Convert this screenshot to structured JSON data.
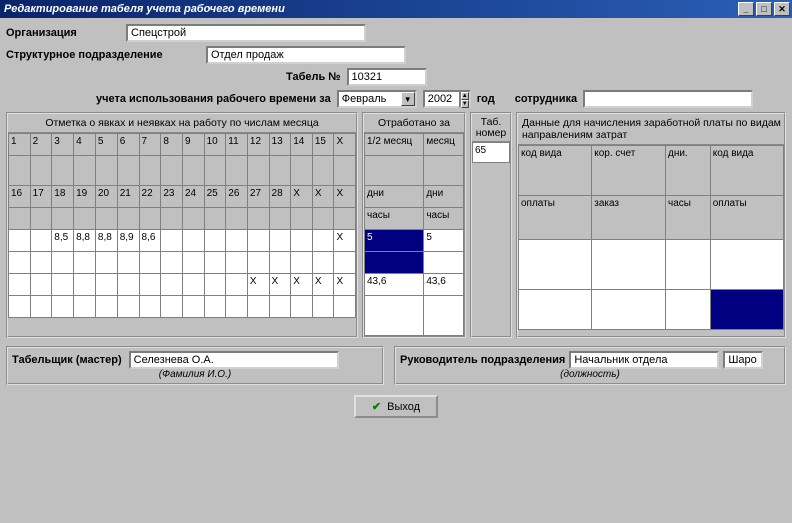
{
  "window": {
    "title": "Редактирование табеля учета рабочего времени"
  },
  "form": {
    "org_label": "Организация",
    "org_value": "Спецстрой",
    "dept_label": "Структурное подразделение",
    "dept_value": "Отдел продаж",
    "tabel_label": "Табель №",
    "tabel_value": "10321",
    "period_label": "учета использования рабочего времени за",
    "month_value": "Февраль",
    "year_value": "2002",
    "year_suffix": "год",
    "employee_label": "сотрудника"
  },
  "panel1": {
    "title": "Отметка о явках и неявках на работу по числам месяца",
    "row1": [
      "1",
      "2",
      "3",
      "4",
      "5",
      "6",
      "7",
      "8",
      "9",
      "10",
      "11",
      "12",
      "13",
      "14",
      "15",
      "X"
    ],
    "row2": [
      "16",
      "17",
      "18",
      "19",
      "20",
      "21",
      "22",
      "23",
      "24",
      "25",
      "26",
      "27",
      "28",
      "X",
      "X",
      "X"
    ],
    "data_rows": [
      [
        "",
        "",
        "8,5",
        "8,8",
        "8,8",
        "8,9",
        "8,6",
        "",
        "",
        "",
        "",
        "",
        "",
        "",
        "",
        "X"
      ],
      [
        "",
        "",
        "",
        "",
        "",
        "",
        "",
        "",
        "",
        "",
        "",
        "X",
        "X",
        "X",
        "X",
        "X"
      ]
    ]
  },
  "panel2": {
    "title": "Отработано за",
    "h1a": "1/2 месяц",
    "h1b": "месяц",
    "h2a": "дни",
    "h2b": "дни",
    "h3a": "часы",
    "h3b": "часы",
    "r1a": "5",
    "r1b": "5",
    "r2a": "",
    "r2b": "",
    "r3a": "43,6",
    "r3b": "43,6"
  },
  "panel3": {
    "title": "Таб. номер",
    "value": "65"
  },
  "panel4": {
    "title": "Данные для начисления заработной платы по видам направлениям затрат",
    "c1": "код вида",
    "c2": "кор. счет",
    "c3": "дни.",
    "c4": "код вида",
    "c5": "оплаты",
    "c6": "заказ",
    "c7": "часы",
    "c8": "оплаты"
  },
  "footer": {
    "tab_label": "Табельщик (мастер)",
    "tab_value": "Селезнева О.А.",
    "tab_hint": "(Фамилия И.О.)",
    "lead_label": "Руководитель подразделения",
    "lead_value": "Начальник отдела",
    "lead_hint": "(должность)",
    "extra": "Шаро"
  },
  "exit_label": "Выход"
}
